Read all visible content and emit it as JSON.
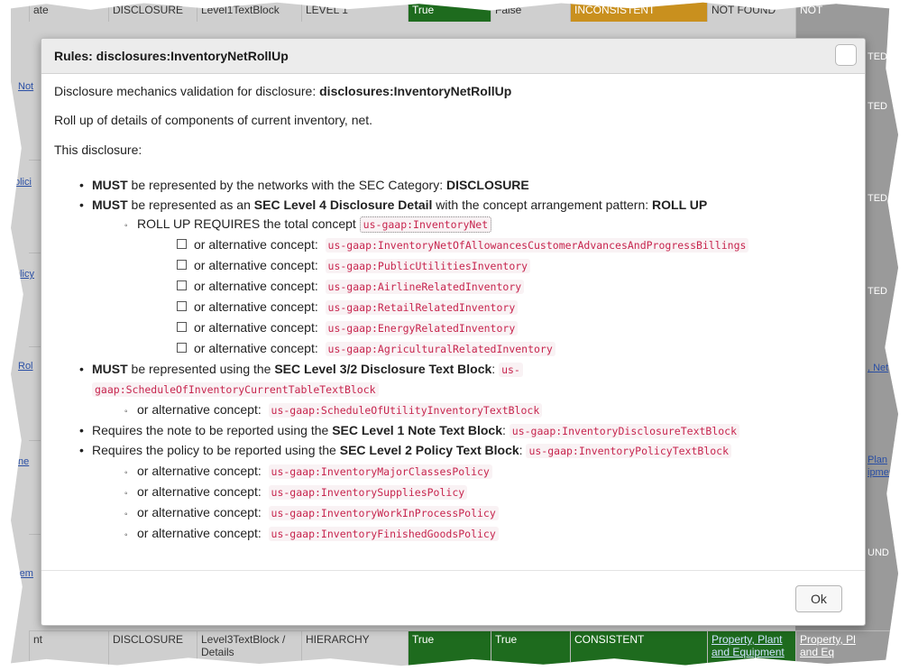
{
  "background": {
    "top_row": [
      "ate",
      "DISCLOSURE",
      "Level1TextBlock",
      "LEVEL 1",
      "True",
      "False",
      "INCONSISTENT",
      "NOT FOUND",
      "NOT"
    ],
    "bottom_row": [
      "nt",
      "DISCLOSURE",
      "Level3TextBlock /",
      "HIERARCHY",
      "True",
      "True",
      "CONSISTENT",
      "Property, Plant",
      "Property, Pl"
    ],
    "bottom_row_2": [
      "Details",
      "and Equipment",
      "and Eq"
    ],
    "left_links": [
      "Not",
      "olici",
      "olicy",
      "Rol",
      "ne",
      "rem"
    ],
    "right_fragments": [
      "TED",
      "TED",
      "TED",
      "TED",
      ", Net",
      "Plan",
      "ipment",
      "UND"
    ]
  },
  "modal": {
    "title": "Rules: disclosures:InventoryNetRollUp",
    "intro_prefix": "Disclosure mechanics validation for disclosure: ",
    "intro_name": "disclosures:InventoryNetRollUp",
    "description": "Roll up of details of components of current inventory, net.",
    "this_disclosure": "This disclosure:",
    "rule1": {
      "must": "MUST",
      "text": " be represented by the networks with the SEC Category: ",
      "category": "DISCLOSURE"
    },
    "rule2": {
      "must": "MUST",
      "text_a": " be represented as an ",
      "level": "SEC Level 4 Disclosure Detail",
      "text_b": " with the concept arrangement pattern: ",
      "pattern": "ROLL UP"
    },
    "rollup": {
      "text": "ROLL UP REQUIRES the total concept ",
      "concept": "us-gaap:InventoryNet"
    },
    "alt_label": "or alternative concept:",
    "rollup_alts": [
      "us-gaap:InventoryNetOfAllowancesCustomerAdvancesAndProgressBillings",
      "us-gaap:PublicUtilitiesInventory",
      "us-gaap:AirlineRelatedInventory",
      "us-gaap:RetailRelatedInventory",
      "us-gaap:EnergyRelatedInventory",
      "us-gaap:AgriculturalRelatedInventory"
    ],
    "rule3": {
      "must": "MUST",
      "text": " be represented using the ",
      "level": "SEC Level 3/2 Disclosure Text Block",
      "colon": ": ",
      "concept_a": "us-",
      "concept_b": "gaap:ScheduleOfInventoryCurrentTableTextBlock"
    },
    "rule3_alt": "us-gaap:ScheduleOfUtilityInventoryTextBlock",
    "rule4": {
      "text": "Requires the note to be reported using the ",
      "level": "SEC Level 1 Note Text Block",
      "colon": ": ",
      "concept": "us-gaap:InventoryDisclosureTextBlock"
    },
    "rule5": {
      "text": "Requires the policy to be reported using the ",
      "level": "SEC Level 2 Policy Text Block",
      "colon": ": ",
      "concept": "us-gaap:InventoryPolicyTextBlock"
    },
    "policy_alts": [
      "us-gaap:InventoryMajorClassesPolicy",
      "us-gaap:InventorySuppliesPolicy",
      "us-gaap:InventoryWorkInProcessPolicy",
      "us-gaap:InventoryFinishedGoodsPolicy"
    ],
    "ok_label": "Ok"
  }
}
